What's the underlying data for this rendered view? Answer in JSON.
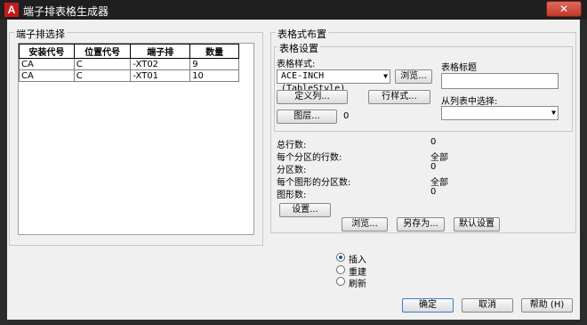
{
  "window": {
    "app_icon_letter": "A",
    "title": "端子排表格生成器",
    "close_glyph": "✕"
  },
  "left_group": {
    "label": "端子排选择",
    "table": {
      "headers": [
        "安装代号",
        "位置代号",
        "端子排",
        "数量"
      ],
      "rows": [
        [
          "CA",
          "C",
          "-XT02",
          "9"
        ],
        [
          "CA",
          "C",
          "-XT01",
          "10"
        ]
      ]
    }
  },
  "right_group": {
    "label": "表格式布置",
    "settings": {
      "label": "表格设置",
      "style_label": "表格样式:",
      "style_value": "ACE-INCH (TableStyle)",
      "browse_label": "浏览...",
      "define_columns_label": "定义列...",
      "row_style_label": "行样式...",
      "layer_label": "图层...",
      "layer_value": "0",
      "table_title_label": "表格标题",
      "table_title_value": "",
      "from_list_label": "从列表中选择:",
      "from_list_value": ""
    },
    "stats": [
      {
        "label": "总行数:",
        "value": "0"
      },
      {
        "label": "每个分区的行数:",
        "value": "全部"
      },
      {
        "label": "分区数:",
        "value": "0"
      },
      {
        "label": "每个图形的分区数:",
        "value": "全部"
      },
      {
        "label": "图形数:",
        "value": "0"
      }
    ],
    "setup_label": "设置...",
    "browse2_label": "浏览...",
    "save_as_label": "另存为...",
    "default_settings_label": "默认设置"
  },
  "insert_options": [
    {
      "label": "插入",
      "selected": true
    },
    {
      "label": "重建",
      "selected": false
    },
    {
      "label": "刷新",
      "selected": false
    }
  ],
  "footer": {
    "ok_label": "确定",
    "cancel_label": "取消",
    "help_label": "帮助 (H)"
  }
}
